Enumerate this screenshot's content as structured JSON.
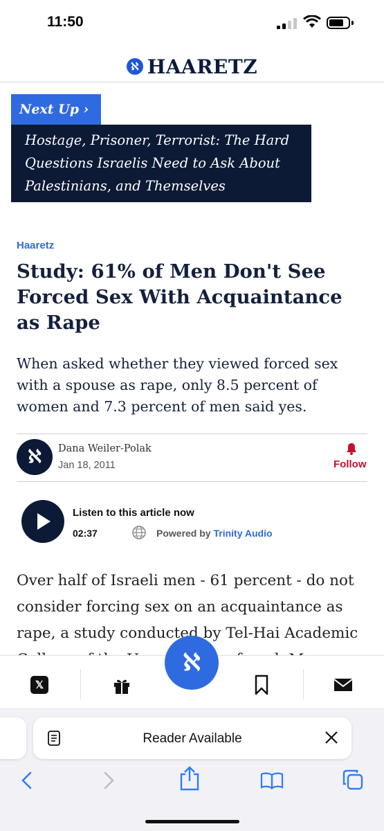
{
  "status_bar": {
    "time": "11:50"
  },
  "header": {
    "logo_mark": "ℵ",
    "logo_text": "HAARETZ"
  },
  "next_up": {
    "label": "Next Up ›",
    "title": "Hostage, Prisoner, Terrorist: The Hard Questions Israelis Need to Ask About Palestinians, and Themselves"
  },
  "article": {
    "source": "Haaretz",
    "headline": "Study: 61% of Men Don't See Forced Sex With Acquaintance as Rape",
    "subhead": "When asked whether they viewed forced sex with a spouse as rape, only 8.5 percent of women and 7.3 percent of men said yes.",
    "author": {
      "name": "Dana Weiler-Polak",
      "date": "Jan 18, 2011",
      "avatar_glyph": "ℵ",
      "follow_label": "Follow"
    },
    "audio": {
      "title": "Listen to this article now",
      "duration": "02:37",
      "powered_by": "Powered by",
      "brand": "Trinity Audio"
    },
    "body": "Over half of Israeli men - 61 percent - do not consider forcing sex on an acquaintance as rape, a study conducted by Tel-Hai Academic College of the Upper Galilee found. Ma"
  },
  "toolbar": {
    "x_label": "𝕏",
    "center_glyph": "ℵ"
  },
  "safari": {
    "reader_label": "Reader Available"
  },
  "colors": {
    "brand_blue": "#2f6be0",
    "navy": "#0d1a36",
    "follow_red": "#c8102e"
  }
}
